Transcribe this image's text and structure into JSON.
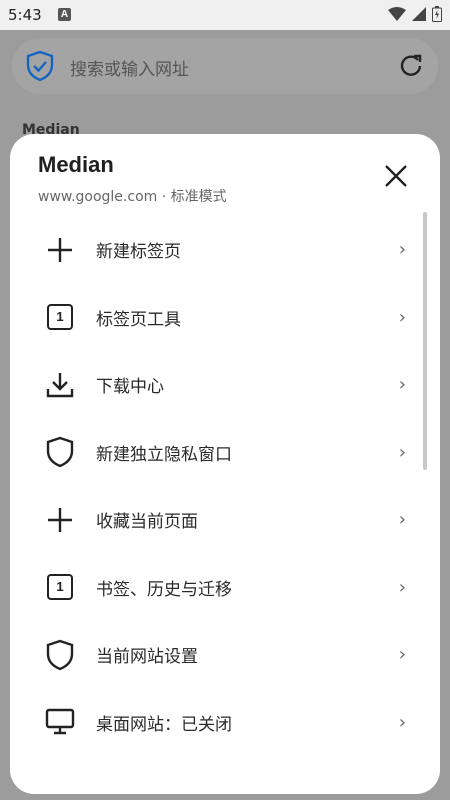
{
  "status_bar": {
    "time": "5:43",
    "notif_letter": "A"
  },
  "browser": {
    "search_placeholder": "搜索或输入网址",
    "background_title": "Median"
  },
  "sheet": {
    "title": "Median",
    "subtitle": "www.google.com · 标准模式",
    "items": [
      {
        "label": "新建标签页",
        "icon": "plus-icon"
      },
      {
        "label": "标签页工具",
        "icon": "tab-count-icon",
        "badge": "1"
      },
      {
        "label": "下载中心",
        "icon": "download-icon"
      },
      {
        "label": "新建独立隐私窗口",
        "icon": "shield-icon"
      },
      {
        "label": "收藏当前页面",
        "icon": "plus-icon"
      },
      {
        "label": "书签、历史与迁移",
        "icon": "tab-count-icon",
        "badge": "1"
      },
      {
        "label": "当前网站设置",
        "icon": "shield-icon"
      },
      {
        "label": "桌面网站：已关闭",
        "icon": "monitor-icon"
      }
    ]
  },
  "colors": {
    "accent_blue": "#1565c0",
    "sheet_bg": "#ffffff",
    "scrim": "#9c9c9c"
  }
}
